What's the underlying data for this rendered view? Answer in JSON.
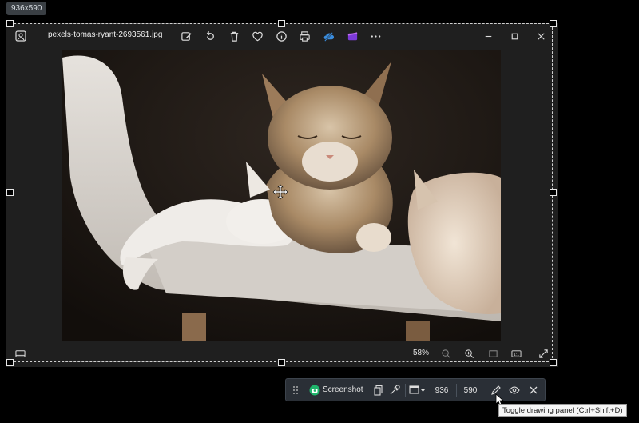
{
  "capture": {
    "size_label": "936x590"
  },
  "viewer": {
    "filename": "pexels-tomas-ryant-2693561.jpg",
    "toolbar_icons": [
      "edit-icon",
      "rotate-icon",
      "delete-icon",
      "favorite-icon",
      "info-icon",
      "print-icon",
      "onedrive-icon",
      "clipchamp-icon",
      "more-icon"
    ],
    "window_controls": [
      "minimize-icon",
      "maximize-icon",
      "close-icon"
    ],
    "zoom": "58%",
    "photo": {
      "subject": "cats on a cat tree"
    }
  },
  "capture_toolbar": {
    "screenshot_label": "Screenshot",
    "width": "936",
    "height": "590",
    "tooltip": "Toggle drawing panel (Ctrl+Shift+D)"
  },
  "colors": {
    "accent_green": "#1fb46b",
    "toolbar_bg": "#2a2f36",
    "viewer_bg": "#1f1f1f"
  }
}
